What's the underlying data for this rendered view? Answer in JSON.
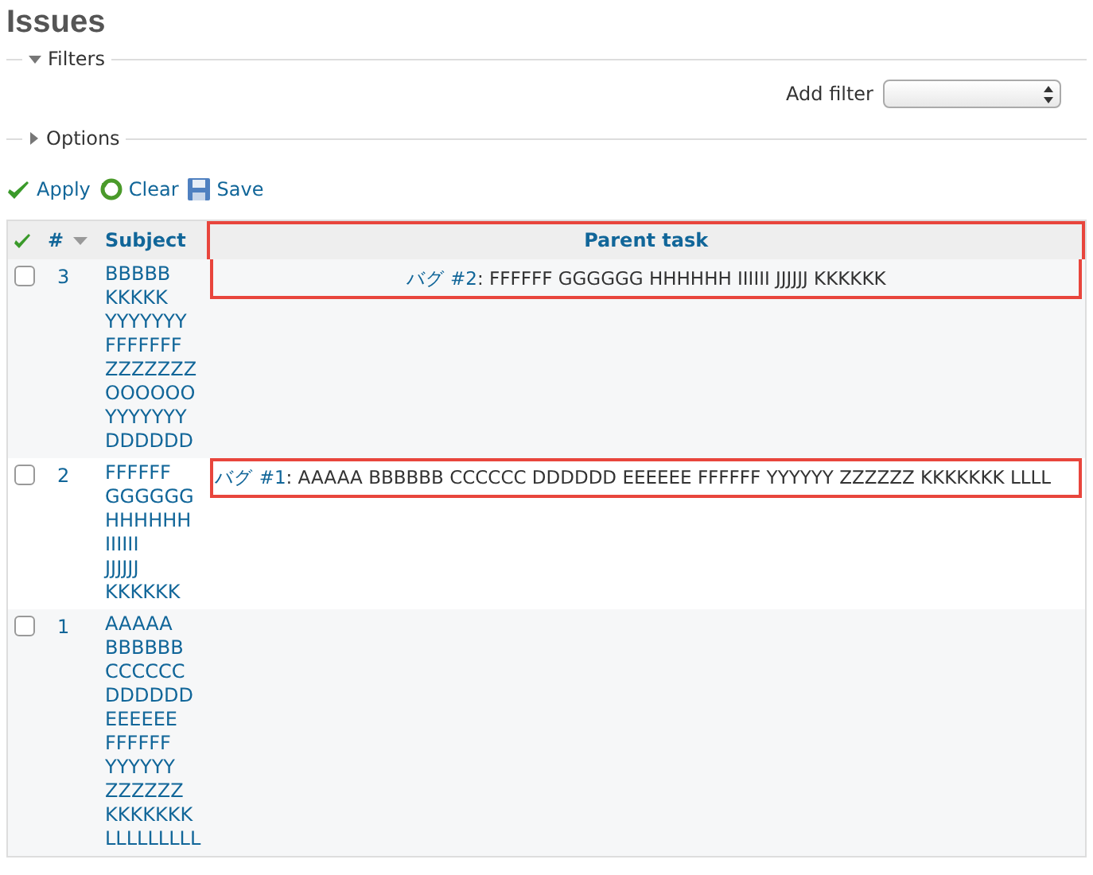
{
  "title": "Issues",
  "fieldsets": [
    {
      "label": "Filters",
      "expanded": true
    },
    {
      "label": "Options",
      "expanded": false
    }
  ],
  "add_filter": {
    "label": "Add filter"
  },
  "actions": [
    {
      "kind": "apply",
      "label": "Apply"
    },
    {
      "kind": "clear",
      "label": "Clear"
    },
    {
      "kind": "save",
      "label": "Save"
    }
  ],
  "table": {
    "columns": [
      {
        "kind": "toggle"
      },
      {
        "kind": "id",
        "label": "#",
        "sorted": true
      },
      {
        "kind": "subject",
        "label": "Subject"
      },
      {
        "kind": "parent",
        "label": "Parent task",
        "highlighted": true
      }
    ],
    "rows": [
      {
        "id": "3",
        "checked": false,
        "subject": "BBBBB KKKKK YYYYYYY FFFFFFF ZZZZZZZ OOOOOO YYYYYYY DDDDDD",
        "parent_link": "バグ #2",
        "parent_text": ": FFFFFF GGGGGG HHHHHH IIIIII JJJJJJ KKKKKK",
        "highlighted": true
      },
      {
        "id": "2",
        "checked": false,
        "subject": "FFFFFF GGGGGG HHHHHH IIIIII JJJJJJ KKKKKK",
        "parent_link": "バグ #1",
        "parent_text": ": AAAAA BBBBBB CCCCCC DDDDDD EEEEEE FFFFFF YYYYYY ZZZZZZ KKKKKKK LLLL",
        "highlighted": true
      },
      {
        "id": "1",
        "checked": false,
        "subject": "AAAAA BBBBBB CCCCCC DDDDDD EEEEEE FFFFFF YYYYYY ZZZZZZ KKKKKKK LLLLLLLLL"
      }
    ]
  }
}
